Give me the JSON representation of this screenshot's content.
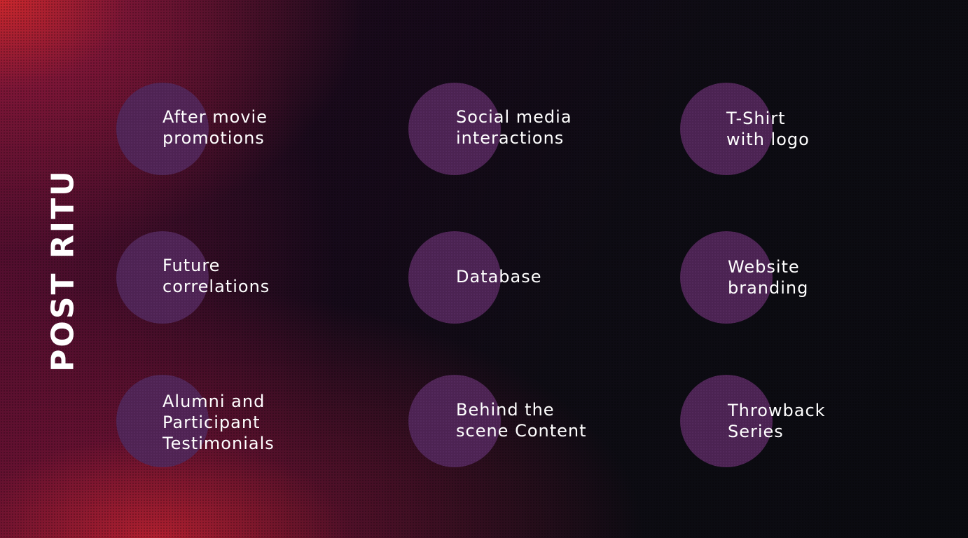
{
  "slide": {
    "title": "POST RITU",
    "items": [
      {
        "line1": "After movie",
        "line2": "promotions",
        "line3": ""
      },
      {
        "line1": "Social media",
        "line2": "interactions",
        "line3": ""
      },
      {
        "line1": "T-Shirt",
        "line2": "with logo",
        "line3": ""
      },
      {
        "line1": "Future",
        "line2": "correlations",
        "line3": ""
      },
      {
        "line1": "Database",
        "line2": "",
        "line3": ""
      },
      {
        "line1": "Website",
        "line2": "branding",
        "line3": ""
      },
      {
        "line1": "Alumni and",
        "line2": "Participant",
        "line3": "Testimonials"
      },
      {
        "line1": "Behind the",
        "line2": "scene Content",
        "line3": ""
      },
      {
        "line1": "Throwback",
        "line2": "Series",
        "line3": ""
      }
    ]
  },
  "colors": {
    "circle": "#4f2556",
    "accent_red": "#d2282d",
    "background_dark": "#0d0a12"
  }
}
